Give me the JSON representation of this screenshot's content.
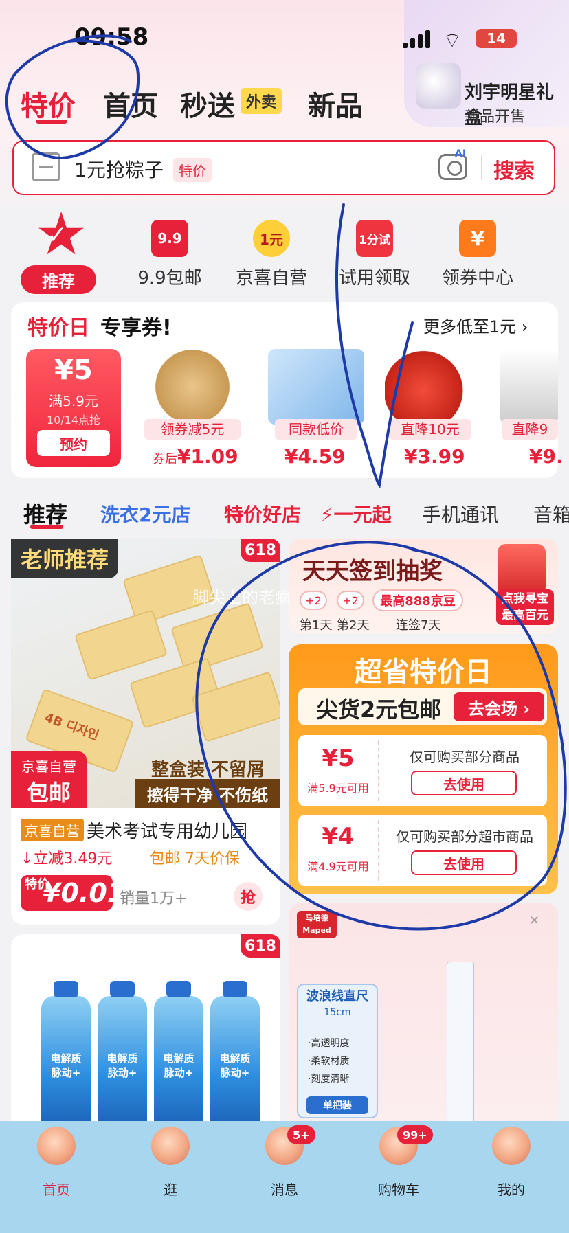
{
  "status_bar": {
    "time": "09:58",
    "battery": "14"
  },
  "top_tabs": [
    {
      "label": "特价"
    },
    {
      "label": "首页"
    },
    {
      "label": "秒送"
    },
    {
      "label": "新品"
    }
  ],
  "waimai_badge": "外卖",
  "promo": {
    "title": "刘宇明星礼盒",
    "subtitle": "新品开售"
  },
  "search": {
    "text": "1元抢粽子",
    "tag": "特价",
    "ai_badge": "AI",
    "button": "搜索"
  },
  "categories": [
    {
      "label": "推荐",
      "icon": "star-check-icon"
    },
    {
      "label": "9.9包邮",
      "icon_text": "9.9"
    },
    {
      "label": "京喜自营",
      "icon_text": "1元"
    },
    {
      "label": "试用领取",
      "icon_text": "1分试"
    },
    {
      "label": "领券中心",
      "icon_text": "¥"
    }
  ],
  "coupon_day": {
    "title_red": "特价日",
    "title_black": "专享券!",
    "more": "更多低至1元 ›",
    "coupon": {
      "amount": "¥5",
      "condition": "满5.9元",
      "time": "10/14点抢",
      "button": "预约"
    },
    "products": [
      {
        "tag": "领券减5元",
        "price_prefix": "券后",
        "price": "¥1.09"
      },
      {
        "tag": "同款低价",
        "price": "¥4.59"
      },
      {
        "tag": "直降10元",
        "price": "¥3.99"
      },
      {
        "tag": "直降9",
        "price": "¥9."
      }
    ]
  },
  "feed_tabs": [
    {
      "label": "推荐"
    },
    {
      "label": "洗衣2元店"
    },
    {
      "label": "特价好店"
    },
    {
      "label": "一元起"
    },
    {
      "label": "手机通讯"
    },
    {
      "label": "音箱"
    }
  ],
  "eraser_card": {
    "teacher_tag": "老师推荐",
    "tag_618": "618",
    "watermark": "脚尖上的老疯酸菜",
    "self_badge_l1": "京喜自营",
    "self_badge_l2": "包邮",
    "slogan1": "整盒装 不留屑",
    "slogan2": "擦得干净 不伤纸",
    "eraser_label": "4B 디자인",
    "self_tag": "京喜自营",
    "title": "美术考试专用幼儿园",
    "discount": "↓立减3.49元",
    "shipping": "包邮  7天价保",
    "price_tag": "特价",
    "price": "¥0.01",
    "sales": "销量1万+",
    "grab": "抢"
  },
  "drink_card": {
    "tag_618": "618",
    "bottle_label": "电解质 脉动+"
  },
  "sign_card": {
    "title": "天天签到抽奖",
    "dot1": "+2",
    "dot2": "+2",
    "bean": "最高888京豆",
    "day1": "第1天",
    "day2": "第2天",
    "day7": "连签7天",
    "treasure_l1": "点我寻宝",
    "treasure_l2": "最高百元"
  },
  "super_day": {
    "title": "超省特价日",
    "subtitle": "尖货2元包邮",
    "go_button": "去会场 ›",
    "vouchers": [
      {
        "amount": "¥5",
        "condition": "满5.9元可用",
        "desc": "仅可购买部分商品",
        "button": "去使用"
      },
      {
        "amount": "¥4",
        "condition": "满4.9元可用",
        "desc": "仅可购买部分超市商品",
        "button": "去使用"
      }
    ]
  },
  "ruler_card": {
    "brand": "马培德 Maped",
    "title": "波浪线直尺",
    "size": "15cm",
    "features": [
      "·高透明度",
      "·柔软材质",
      "·刻度清晰"
    ],
    "single": "单把装"
  },
  "bottom_nav": [
    {
      "label": "首页",
      "active": true
    },
    {
      "label": "逛"
    },
    {
      "label": "消息",
      "badge": "5+"
    },
    {
      "label": "购物车",
      "badge": "99+"
    },
    {
      "label": "我的"
    }
  ],
  "colors": {
    "brand_red": "#e8213a",
    "orange": "#ff9a1c",
    "nav_bg": "#a8d6ef",
    "annotation_blue": "#1e3aa8"
  }
}
